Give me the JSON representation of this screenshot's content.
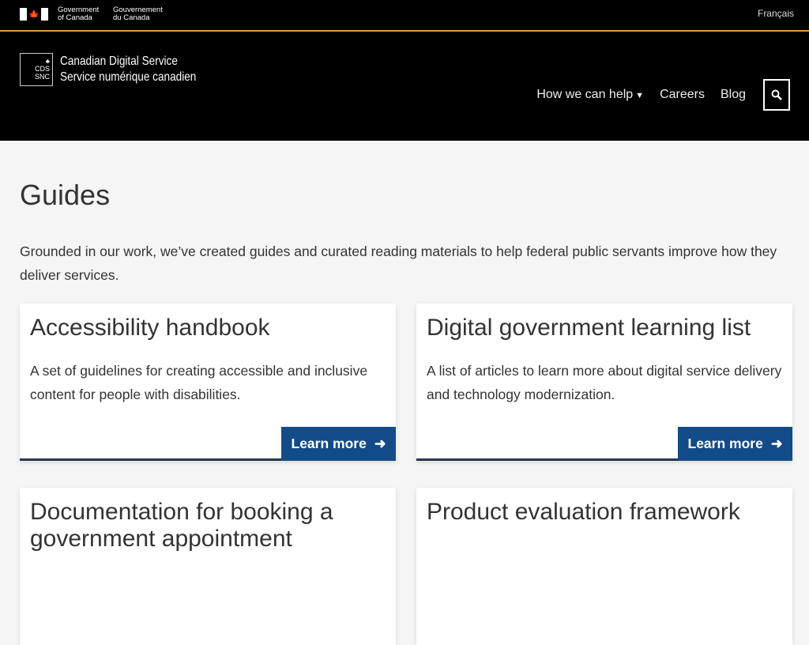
{
  "fip": {
    "gov_en_line1": "Government",
    "gov_en_line2": "of Canada",
    "gov_fr_line1": "Gouvernement",
    "gov_fr_line2": "du Canada",
    "language_link": "Français"
  },
  "header": {
    "logo_line1": "CDS",
    "logo_line2": "SNC",
    "name_en": "Canadian Digital Service",
    "name_fr": "Service numérique canadien",
    "nav": [
      {
        "label": "How we can help",
        "has_dropdown": true
      },
      {
        "label": "Careers"
      },
      {
        "label": "Blog"
      }
    ],
    "search_icon": "search-icon"
  },
  "page": {
    "title": "Guides",
    "intro": "Grounded in our work, we’ve created guides and curated reading materials to help federal public servants improve how they deliver services."
  },
  "cards": [
    {
      "title": "Accessibility handbook",
      "description": "A set of guidelines for creating accessible and inclusive content for people with disabilities.",
      "cta": "Learn more"
    },
    {
      "title": "Digital government learning list",
      "description": "A list of articles to learn more about digital service delivery and technology modernization.",
      "cta": "Learn more"
    },
    {
      "title": "Documentation for booking a government appointment",
      "description": "",
      "cta": ""
    },
    {
      "title": "Product evaluation framework",
      "description": "",
      "cta": ""
    }
  ],
  "colors": {
    "accent": "#d3a04a",
    "button": "#124b88",
    "header_bg": "#000000"
  }
}
